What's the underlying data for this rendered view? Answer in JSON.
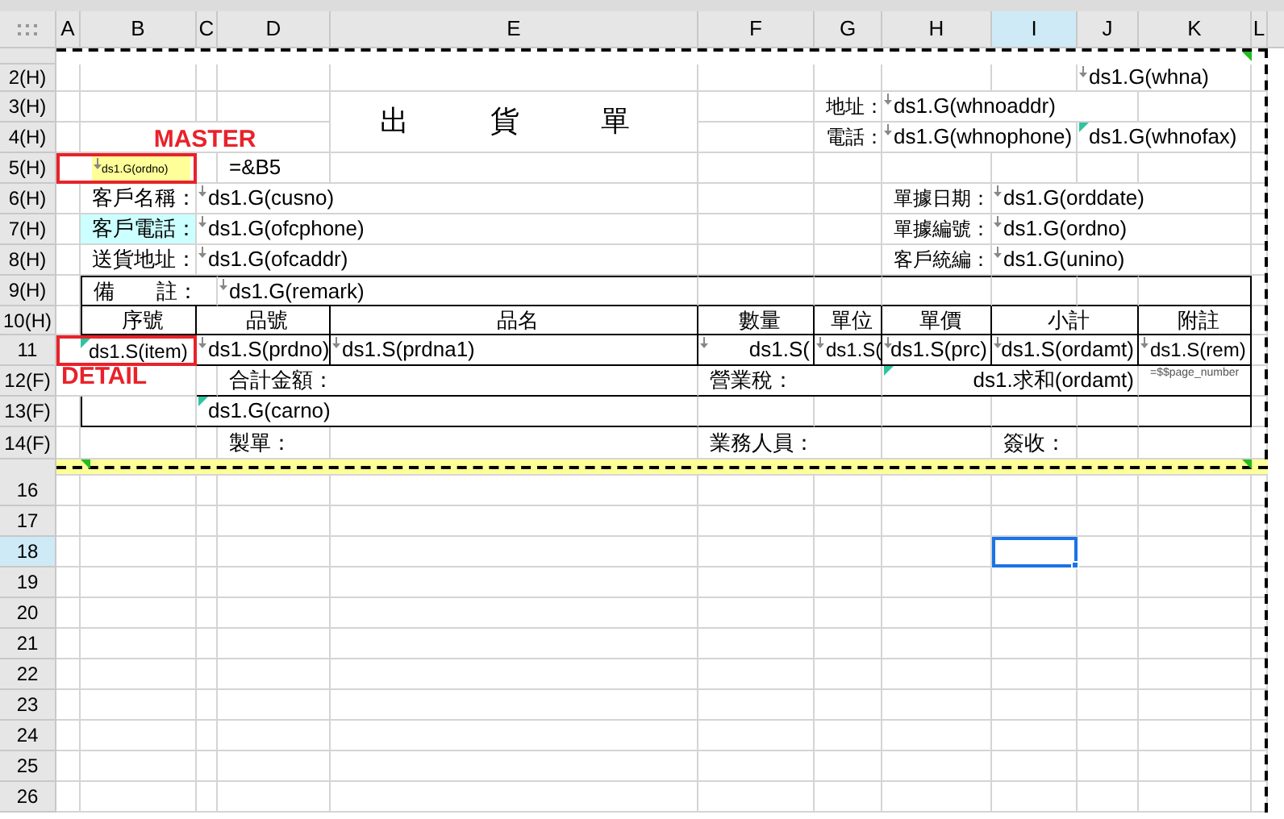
{
  "column_headers": [
    {
      "label": "A",
      "selected": false
    },
    {
      "label": "B",
      "selected": false
    },
    {
      "label": "C",
      "selected": false
    },
    {
      "label": "D",
      "selected": false
    },
    {
      "label": "E",
      "selected": false
    },
    {
      "label": "F",
      "selected": false
    },
    {
      "label": "G",
      "selected": false
    },
    {
      "label": "H",
      "selected": false
    },
    {
      "label": "I",
      "selected": true
    },
    {
      "label": "J",
      "selected": false
    },
    {
      "label": "K",
      "selected": false
    },
    {
      "label": "L",
      "selected": false
    }
  ],
  "row_headers": [
    {
      "label": "2(H)",
      "selected": false
    },
    {
      "label": "3(H)",
      "selected": false
    },
    {
      "label": "4(H)",
      "selected": false
    },
    {
      "label": "5(H)",
      "selected": false
    },
    {
      "label": "6(H)",
      "selected": false
    },
    {
      "label": "7(H)",
      "selected": false
    },
    {
      "label": "8(H)",
      "selected": false
    },
    {
      "label": "9(H)",
      "selected": false
    },
    {
      "label": "10(H)",
      "selected": false
    },
    {
      "label": "11",
      "selected": false
    },
    {
      "label": "12(F)",
      "selected": false
    },
    {
      "label": "13(F)",
      "selected": false
    },
    {
      "label": "14(F)",
      "selected": false
    },
    {
      "label": "16",
      "selected": false
    },
    {
      "label": "17",
      "selected": false
    },
    {
      "label": "18",
      "selected": true
    },
    {
      "label": "19",
      "selected": false
    },
    {
      "label": "20",
      "selected": false
    },
    {
      "label": "21",
      "selected": false
    },
    {
      "label": "22",
      "selected": false
    },
    {
      "label": "23",
      "selected": false
    },
    {
      "label": "24",
      "selected": false
    },
    {
      "label": "25",
      "selected": false
    },
    {
      "label": "26",
      "selected": false
    }
  ],
  "bands": [
    {
      "text": "MASTER"
    },
    {
      "text": "DETAIL"
    }
  ],
  "cells": [
    {
      "text": "ds1.G(whna)",
      "kind": "arrow"
    },
    {
      "text": "地址：",
      "kind": "plain"
    },
    {
      "text": "ds1.G(whnoaddr)",
      "kind": "arrow"
    },
    {
      "text": "出　貨　單",
      "kind": "plain"
    },
    {
      "text": "電話：",
      "kind": "plain"
    },
    {
      "text": "ds1.G(whnophone)",
      "kind": "arrow"
    },
    {
      "text": "ds1.G(whnofax)",
      "kind": "flag"
    },
    {
      "text": "ds1.G(ordno)",
      "kind": "arrow",
      "color": "#ffff99"
    },
    {
      "text": "=&B5",
      "kind": "plain"
    },
    {
      "text": "客戶名稱：",
      "kind": "plain"
    },
    {
      "text": "ds1.G(cusno)",
      "kind": "arrow"
    },
    {
      "text": "單據日期：",
      "kind": "plain"
    },
    {
      "text": "ds1.G(orddate)",
      "kind": "arrow"
    },
    {
      "text": "客戶電話：",
      "kind": "plain",
      "color": "#ccffff"
    },
    {
      "text": "ds1.G(ofcphone)",
      "kind": "arrow"
    },
    {
      "text": "單據編號：",
      "kind": "plain"
    },
    {
      "text": "ds1.G(ordno)",
      "kind": "arrow"
    },
    {
      "text": "送貨地址：",
      "kind": "plain"
    },
    {
      "text": "ds1.G(ofcaddr)",
      "kind": "arrow"
    },
    {
      "text": "客戶統編：",
      "kind": "plain"
    },
    {
      "text": "ds1.G(unino)",
      "kind": "arrow"
    },
    {
      "text": "備　　註：",
      "kind": "plain"
    },
    {
      "text": "ds1.G(remark)",
      "kind": "arrow"
    },
    {
      "text": "序號",
      "kind": "plain"
    },
    {
      "text": "品號",
      "kind": "plain"
    },
    {
      "text": "品名",
      "kind": "plain"
    },
    {
      "text": "數量",
      "kind": "plain"
    },
    {
      "text": "單位",
      "kind": "plain"
    },
    {
      "text": "單價",
      "kind": "plain"
    },
    {
      "text": "小計",
      "kind": "plain"
    },
    {
      "text": "附註",
      "kind": "plain"
    },
    {
      "text": "ds1.S(item)",
      "kind": "flag"
    },
    {
      "text": "ds1.S(prdno)",
      "kind": "arrow"
    },
    {
      "text": "ds1.S(prdna1)",
      "kind": "arrow"
    },
    {
      "text": "ds1.S(",
      "kind": "arrow"
    },
    {
      "text": "ds1.S(",
      "kind": "arrow"
    },
    {
      "text": "ds1.S(prc)",
      "kind": "arrow"
    },
    {
      "text": "ds1.S(ordamt)",
      "kind": "arrow"
    },
    {
      "text": "ds1.S(rem)",
      "kind": "arrow"
    },
    {
      "text": "合計金額：",
      "kind": "plain"
    },
    {
      "text": "營業稅：",
      "kind": "plain"
    },
    {
      "text": "ds1.求和(ordamt)",
      "kind": "flag"
    },
    {
      "text": "=$$page_number",
      "kind": "plain"
    },
    {
      "text": "ds1.G(carno)",
      "kind": "flag"
    },
    {
      "text": "製單：",
      "kind": "plain"
    },
    {
      "text": "業務人員：",
      "kind": "plain"
    },
    {
      "text": "簽收：",
      "kind": "plain"
    }
  ]
}
